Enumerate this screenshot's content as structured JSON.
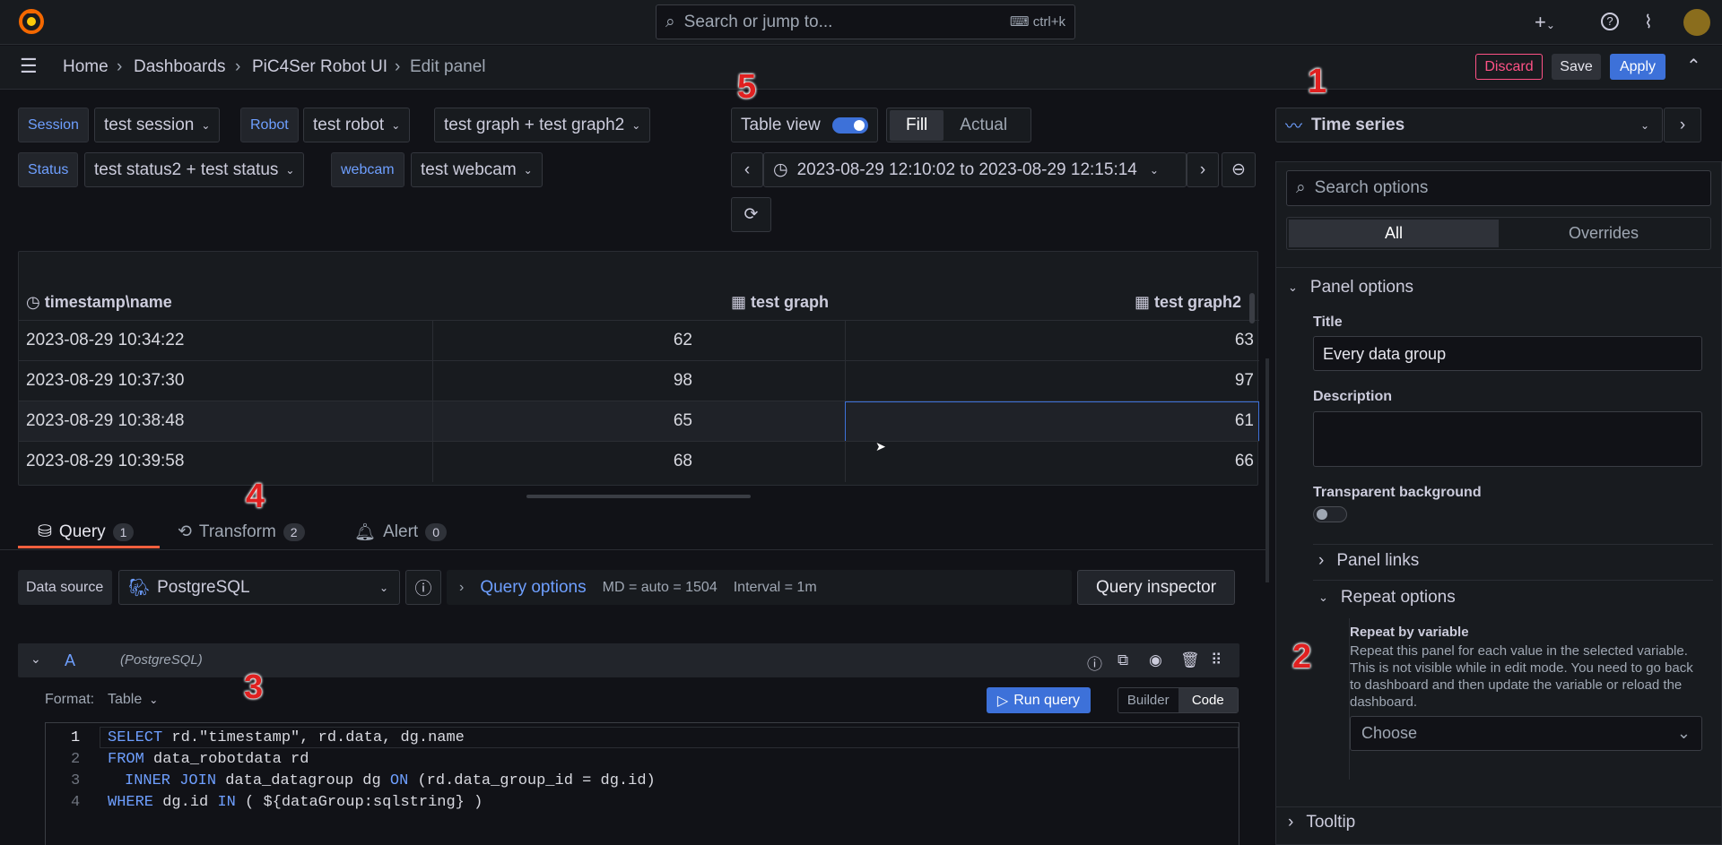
{
  "topbar": {
    "search_placeholder": "Search or jump to...",
    "shortcut": "ctrl+k"
  },
  "breadcrumb": {
    "home": "Home",
    "dashboards": "Dashboards",
    "dashboard": "PiC4Ser Robot UI",
    "current": "Edit panel"
  },
  "actions": {
    "discard": "Discard",
    "save": "Save",
    "apply": "Apply"
  },
  "variables": {
    "session_label": "Session",
    "session_value": "test session",
    "robot_label": "Robot",
    "robot_value": "test robot",
    "graph_value": "test graph + test graph2",
    "status_label": "Status",
    "status_value": "test status2 + test status",
    "webcam_label": "webcam",
    "webcam_value": "test webcam"
  },
  "view": {
    "table_view": "Table view",
    "fill": "Fill",
    "actual": "Actual",
    "table_view_on": true
  },
  "timerange": {
    "label": "2023-08-29 12:10:02 to 2023-08-29 12:15:14"
  },
  "table": {
    "headers": [
      "timestamp\\name",
      "test graph",
      "test graph2"
    ],
    "rows": [
      {
        "ts": "2023-08-29 10:34:22",
        "a": "62",
        "b": "63"
      },
      {
        "ts": "2023-08-29 10:37:30",
        "a": "98",
        "b": "97"
      },
      {
        "ts": "2023-08-29 10:38:48",
        "a": "65",
        "b": "61"
      },
      {
        "ts": "2023-08-29 10:39:58",
        "a": "68",
        "b": "66"
      }
    ]
  },
  "query_tabs": [
    {
      "label": "Query",
      "count": "1"
    },
    {
      "label": "Transform",
      "count": "2"
    },
    {
      "label": "Alert",
      "count": "0"
    }
  ],
  "datasource": {
    "label": "Data source",
    "name": "PostgreSQL",
    "query_options": "Query options",
    "md": "MD = auto = 1504",
    "interval": "Interval = 1m",
    "inspector": "Query inspector"
  },
  "query": {
    "ref": "A",
    "source": "(PostgreSQL)",
    "format_label": "Format:",
    "format_value": "Table",
    "run": "Run query",
    "builder": "Builder",
    "code": "Code"
  },
  "sql_lines": [
    {
      "n": "1",
      "text": "SELECT rd.\"timestamp\", rd.data, dg.name"
    },
    {
      "n": "2",
      "text": "FROM data_robotdata rd"
    },
    {
      "n": "3",
      "text": "INNER JOIN data_datagroup dg ON (rd.data_group_id = dg.id)"
    },
    {
      "n": "4",
      "text": "WHERE dg.id IN ( ${dataGroup:sqlstring} )"
    }
  ],
  "options": {
    "viz": "Time series",
    "search_placeholder": "Search options",
    "all": "All",
    "overrides": "Overrides",
    "panel_options": "Panel options",
    "title_label": "Title",
    "title_value": "Every data group",
    "description_label": "Description",
    "transparent_label": "Transparent background",
    "panel_links": "Panel links",
    "repeat_options": "Repeat options",
    "repeat_by": "Repeat by variable",
    "repeat_help": "Repeat this panel for each value in the selected variable. This is not visible while in edit mode. You need to go back to dashboard and then update the variable or reload the dashboard.",
    "choose": "Choose",
    "tooltip": "Tooltip"
  },
  "annotations": [
    "1",
    "2",
    "3",
    "4",
    "5"
  ],
  "colors": {
    "accent": "#3d71d9",
    "discard": "#ff5286",
    "annot": "#e02020"
  }
}
